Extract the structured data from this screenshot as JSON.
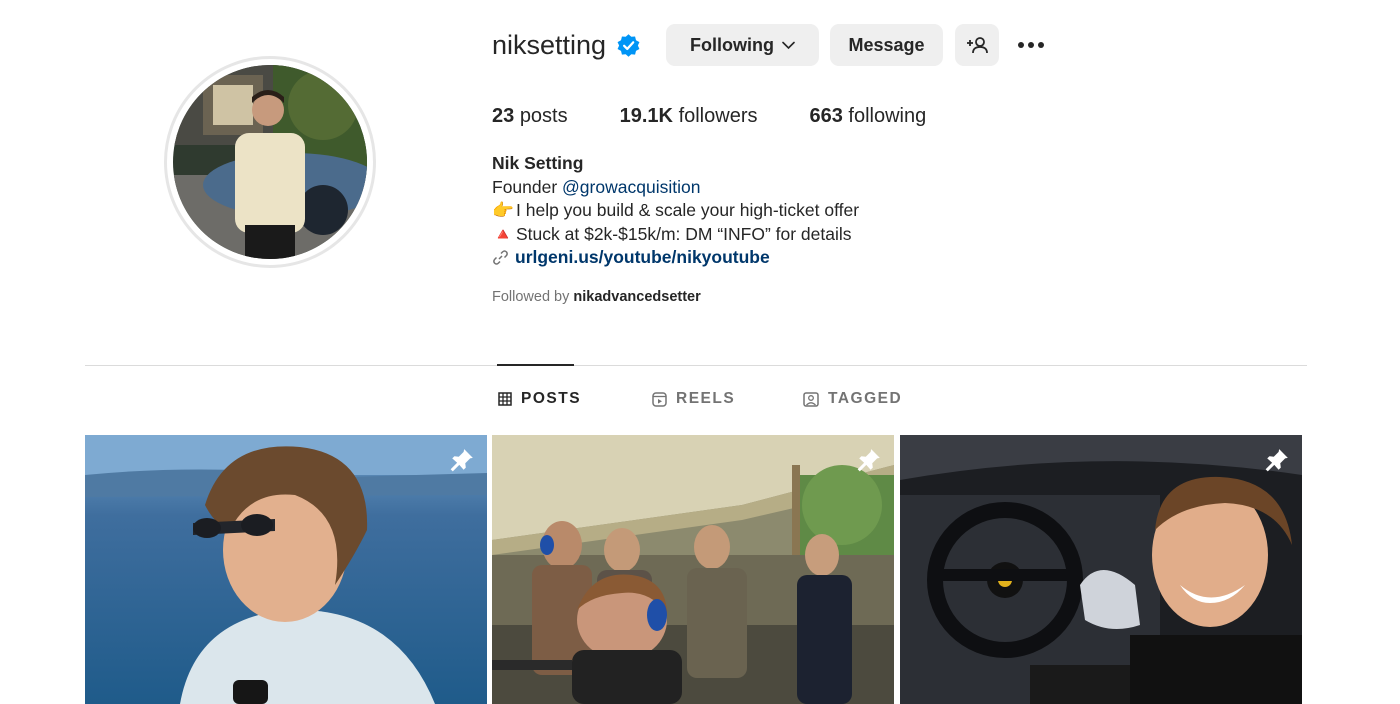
{
  "profile": {
    "username": "niksetting",
    "following_label": "Following",
    "message_label": "Message",
    "avatar_icon": "profile-photo",
    "verified_color": "#0095f6"
  },
  "stats": {
    "posts_count": "23",
    "posts_label": "posts",
    "followers_count": "19.1K",
    "followers_label": "followers",
    "following_count": "663",
    "following_label": "following"
  },
  "bio": {
    "name": "Nik Setting",
    "line1_prefix": "Founder ",
    "line1_mention": "@growacquisition",
    "line2_emoji": "👉",
    "line2_text": "I help you build & scale your high-ticket offer",
    "line3_emoji": "🔺",
    "line3_text": "Stuck at $2k-$15k/m: DM “INFO” for details",
    "link": "urlgeni.us/youtube/nikyoutube",
    "followed_by_prefix": "Followed by ",
    "followed_by_user": "nikadvancedsetter"
  },
  "tabs": [
    {
      "label": "POSTS",
      "icon": "grid-icon",
      "active": true
    },
    {
      "label": "REELS",
      "icon": "reels-icon",
      "active": false
    },
    {
      "label": "TAGGED",
      "icon": "tagged-icon",
      "active": false
    }
  ],
  "posts": [
    {
      "icon": "pinned-icon"
    },
    {
      "icon": "pinned-icon"
    },
    {
      "icon": "pinned-icon"
    }
  ]
}
